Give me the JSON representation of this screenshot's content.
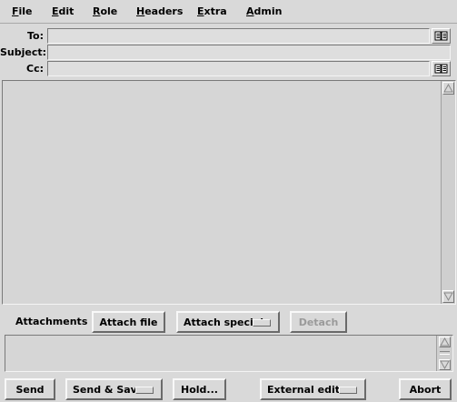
{
  "menubar": {
    "items": [
      {
        "label": "File",
        "mnemonic": "F",
        "rest": "ile"
      },
      {
        "label": "Edit",
        "mnemonic": "E",
        "rest": "dit"
      },
      {
        "label": "Role",
        "mnemonic": "R",
        "rest": "ole"
      },
      {
        "label": "Headers",
        "mnemonic": "H",
        "rest": "eaders"
      },
      {
        "label": "Extra",
        "mnemonic": "E",
        "rest": "xtra"
      },
      {
        "label": "Admin",
        "mnemonic": "A",
        "rest": "dmin"
      }
    ]
  },
  "header": {
    "to_label": "To:",
    "to_value": "",
    "subject_label": "Subject:",
    "subject_value": "",
    "cc_label": "Cc:",
    "cc_value": ""
  },
  "body_text": "",
  "attachments": {
    "label": "Attachments",
    "attach_file": "Attach file",
    "attach_special": "Attach special",
    "detach": "Detach"
  },
  "actions": {
    "send": "Send",
    "send_save": "Send & Save",
    "hold": "Hold...",
    "external_editor": "External editor",
    "abort": "Abort"
  },
  "icons": {
    "address_book": "address-book-icon",
    "scroll_up": "arrow-up-icon",
    "scroll_down": "arrow-down-icon"
  }
}
